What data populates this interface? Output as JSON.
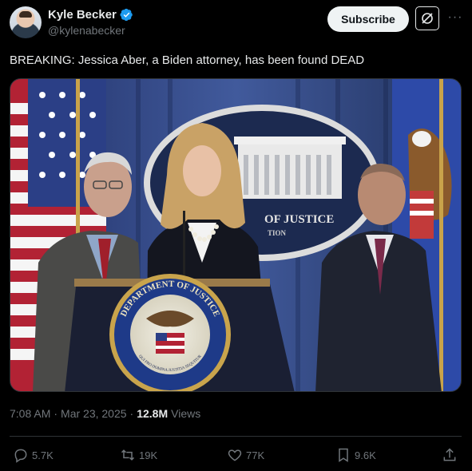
{
  "author": {
    "name": "Kyle Becker",
    "handle": "@kylenabecker"
  },
  "header": {
    "subscribe_label": "Subscribe",
    "more_label": "···"
  },
  "tweet": {
    "text": "BREAKING: Jessica Aber, a Biden attorney, has been found DEAD"
  },
  "image_text": {
    "backdrop_text": "OF JUSTICE",
    "backdrop_text_2": "TION",
    "seal_text_top": "DEPARTMENT OF JUSTICE",
    "seal_text_bottom": "QUI PRO DOMINA JUSTITIA SEQUITUR"
  },
  "meta": {
    "time": "7:08 AM",
    "separator": "·",
    "date": "Mar 23, 2025",
    "separator2": "·",
    "views_count": "12.8M",
    "views_label": "Views"
  },
  "actions": {
    "replies": "5.7K",
    "reposts": "19K",
    "likes": "77K",
    "bookmarks": "9.6K"
  },
  "colors": {
    "background": "#000000",
    "text": "#e7e9ea",
    "muted": "#71767b",
    "verified": "#1d9bf0"
  }
}
